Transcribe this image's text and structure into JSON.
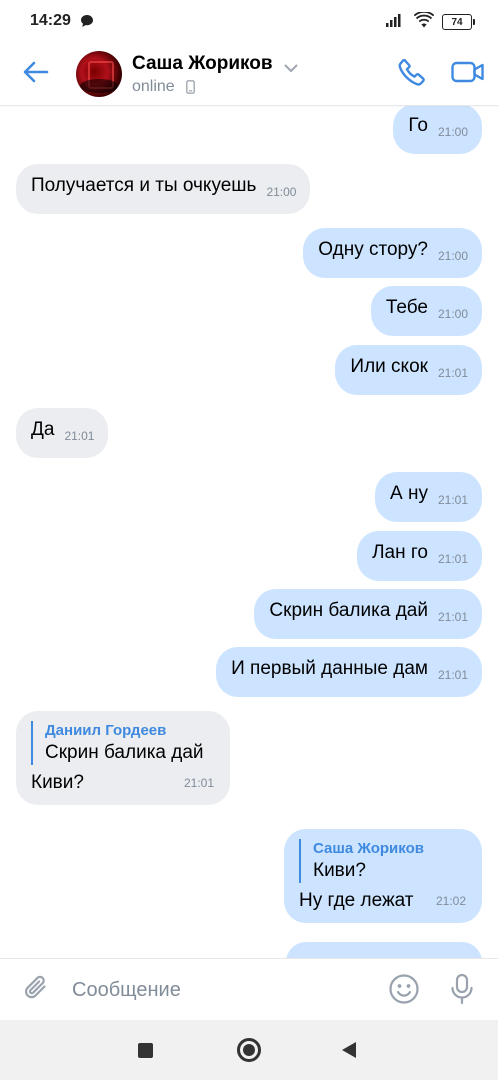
{
  "status_bar": {
    "time": "14:29",
    "battery": "74",
    "icons": [
      "chat-icon",
      "signal-icon",
      "wifi-icon",
      "battery-icon"
    ]
  },
  "header": {
    "name": "Саша Жориков",
    "status": "online",
    "icons": [
      "back-arrow-icon",
      "chevron-down-icon",
      "mobile-phone-icon",
      "phone-icon",
      "video-camera-icon"
    ]
  },
  "messages": [
    {
      "direction": "out",
      "text": "Го",
      "time": "21:00"
    },
    {
      "direction": "in",
      "text": "Получается и ты очкуешь",
      "time": "21:00"
    },
    {
      "direction": "out",
      "text": "Одну стору?",
      "time": "21:00"
    },
    {
      "direction": "out",
      "text": "Тебе",
      "time": "21:00"
    },
    {
      "direction": "out",
      "text": "Или скок",
      "time": "21:01"
    },
    {
      "direction": "in",
      "text": "Да",
      "time": "21:01"
    },
    {
      "direction": "out",
      "text": "А ну",
      "time": "21:01"
    },
    {
      "direction": "out",
      "text": "Лан го",
      "time": "21:01"
    },
    {
      "direction": "out",
      "text": "Скрин балика дай",
      "time": "21:01"
    },
    {
      "direction": "out",
      "text": "И первый данные дам",
      "time": "21:01"
    },
    {
      "direction": "in",
      "reply_author": "Даниил Гордеев",
      "reply_text": "Скрин балика дай",
      "text": "Киви?",
      "time": "21:01"
    },
    {
      "direction": "out",
      "reply_author": "Саша Жориков",
      "reply_text": "Киви?",
      "text": "Ну где лежат",
      "time": "21:02"
    }
  ],
  "composer": {
    "placeholder": "Сообщение",
    "icons": [
      "paperclip-icon",
      "smile-icon",
      "microphone-icon"
    ]
  },
  "colors": {
    "accent": "#3f8ae0",
    "incoming_bubble": "#ebedf0",
    "outgoing_bubble": "#cce4ff",
    "secondary_text": "#818c99"
  }
}
